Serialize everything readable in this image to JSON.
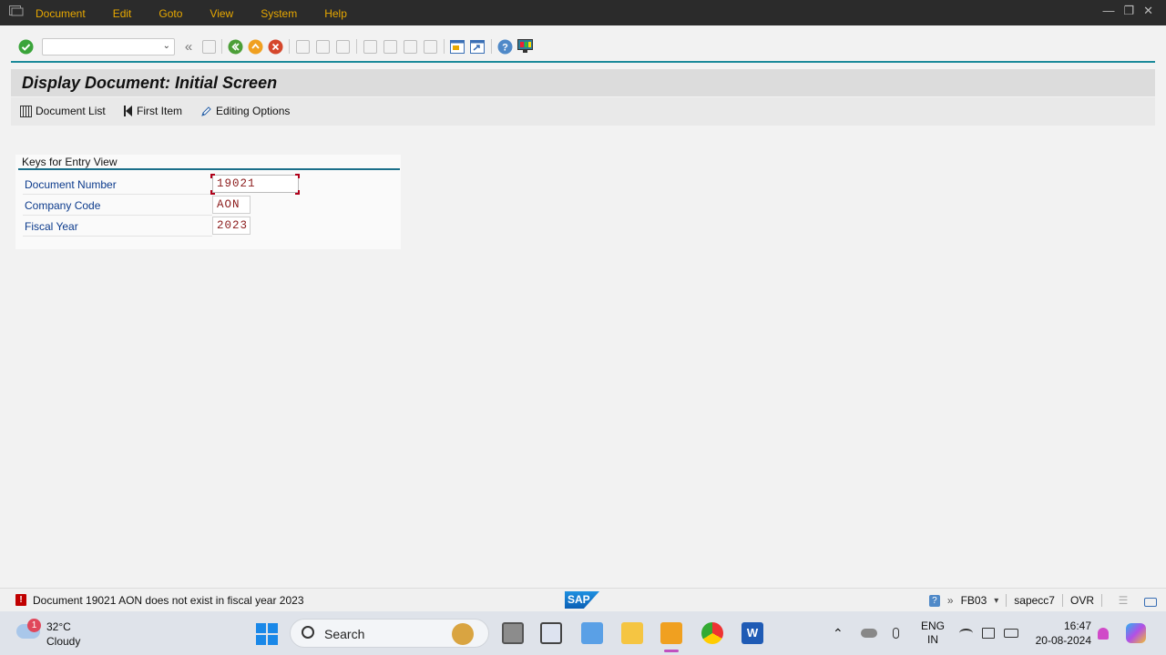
{
  "menubar": {
    "items": [
      "Document",
      "Edit",
      "Goto",
      "View",
      "System",
      "Help"
    ]
  },
  "toolbar": {
    "command_field_value": "",
    "icons": [
      "enter-icon",
      "save-icon",
      "back-icon",
      "exit-icon",
      "cancel-icon",
      "print-icon",
      "find-icon",
      "find-next-icon",
      "first-page-icon",
      "previous-page-icon",
      "next-page-icon",
      "last-page-icon",
      "new-session-icon",
      "shortcut-icon",
      "help-icon",
      "customize-layout-icon"
    ]
  },
  "title": "Display Document: Initial Screen",
  "app_toolbar": {
    "document_list": "Document List",
    "first_item": "First Item",
    "editing_options": "Editing Options"
  },
  "form": {
    "group_title": "Keys for Entry View",
    "fields": [
      {
        "label": "Document Number",
        "value": "19021"
      },
      {
        "label": "Company Code",
        "value": "AON"
      },
      {
        "label": "Fiscal Year",
        "value": "2023"
      }
    ]
  },
  "status": {
    "type": "error",
    "message": "Document 19021 AON does not exist in fiscal year 2023",
    "logo": "SAP",
    "transaction": "FB03",
    "system": "sapecc7",
    "mode": "OVR"
  },
  "taskbar": {
    "weather_badge": "1",
    "temperature": "32°C",
    "condition": "Cloudy",
    "search_label": "Search",
    "language_1": "ENG",
    "language_2": "IN",
    "time": "16:47",
    "date": "20-08-2024"
  },
  "colors": {
    "menu_text": "#e8a800",
    "field_value": "#8b1a1a",
    "label_blue": "#0b3a8c",
    "accent_teal": "#1b8a9a",
    "error_red": "#c00000"
  }
}
